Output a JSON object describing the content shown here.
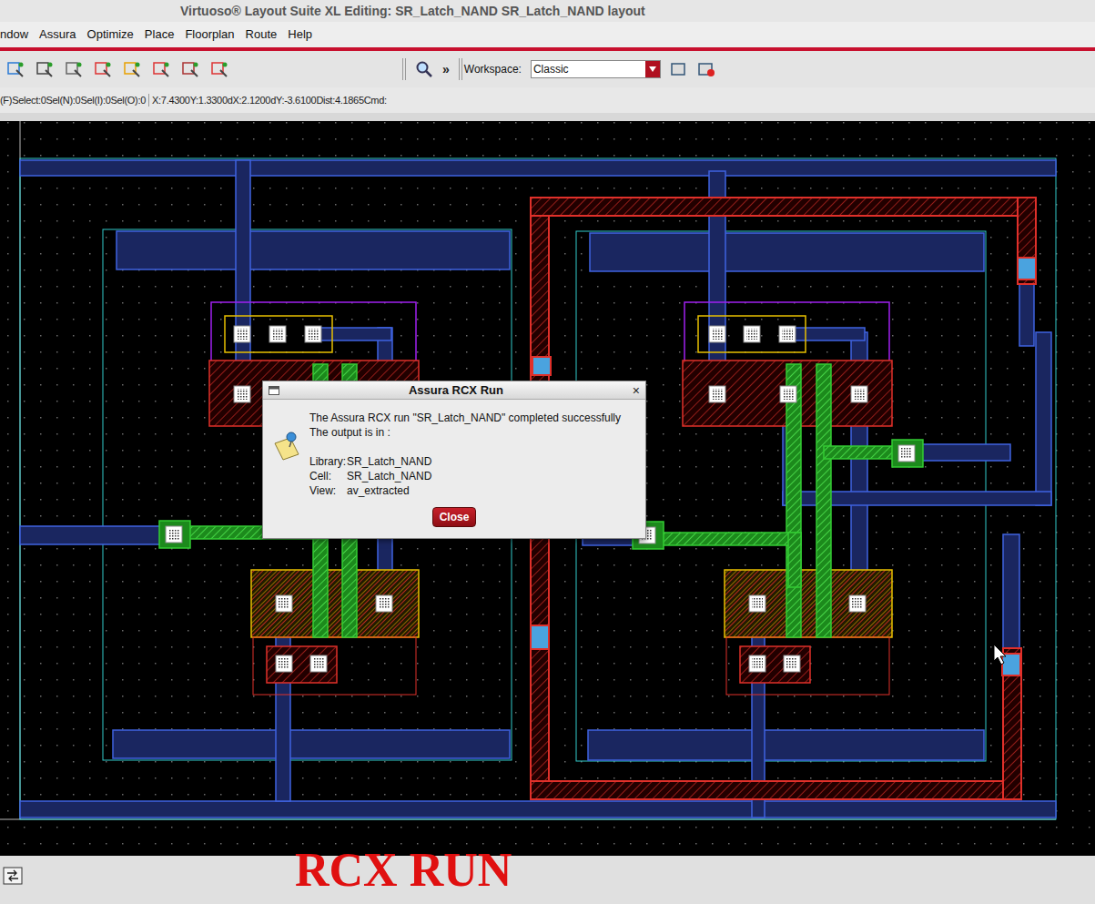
{
  "window": {
    "title": "Virtuoso® Layout Suite XL Editing: SR_Latch_NAND SR_Latch_NAND layout"
  },
  "menu": [
    "ndow",
    "Assura",
    "Optimize",
    "Place",
    "Floorplan",
    "Route",
    "Help"
  ],
  "toolbar": {
    "more": "»",
    "workspace_label": "Workspace:",
    "workspace_value": "Classic"
  },
  "status_bar": {
    "selection": "(F)Select:0Sel(N):0Sel(I):0Sel(O):0",
    "coords": "X:7.4300Y:1.3300dX:2.1200dY:-3.6100Dist:4.1865Cmd:"
  },
  "dialog": {
    "title": "Assura RCX Run",
    "close_glyph": "×",
    "lines": [
      "The Assura RCX run \"SR_Latch_NAND\" completed successfully",
      "The output is in :"
    ],
    "details": [
      {
        "label": "Library:",
        "value": "SR_Latch_NAND"
      },
      {
        "label": "Cell:",
        "value": "SR_Latch_NAND"
      },
      {
        "label": "View:",
        "value": "av_extracted"
      }
    ],
    "button": "Close"
  },
  "caption": "RCX RUN"
}
